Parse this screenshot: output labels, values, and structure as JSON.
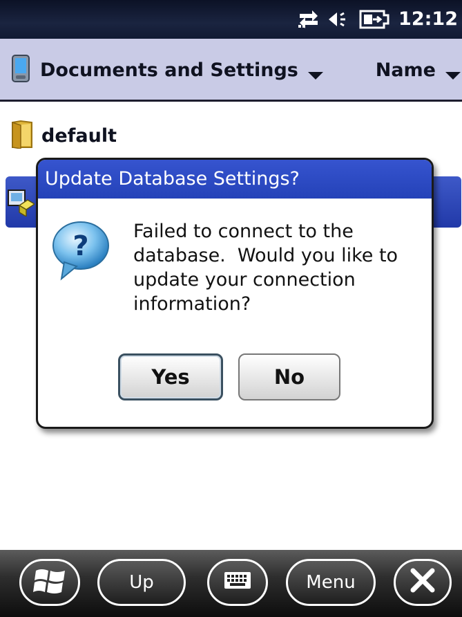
{
  "status": {
    "time": "12:12",
    "icons": [
      "connectivity-icon",
      "speaker-icon",
      "battery-icon"
    ]
  },
  "header": {
    "path_label": "Documents and Settings",
    "sort_label": "Name",
    "icons": [
      "device-icon",
      "chevron-down-icon"
    ]
  },
  "list": {
    "items": [
      {
        "label": "default",
        "icon": "folder-icon"
      }
    ],
    "selected_item_icon": "package-icon"
  },
  "dialog": {
    "title": "Update Database Settings?",
    "message": "Failed to connect to the database.  Would you like to update your connection information?",
    "icon": "question-icon",
    "yes_label": "Yes",
    "no_label": "No"
  },
  "bottombar": {
    "up_label": "Up",
    "menu_label": "Menu",
    "icons": [
      "windows-start-icon",
      "keyboard-icon",
      "close-icon"
    ]
  }
}
